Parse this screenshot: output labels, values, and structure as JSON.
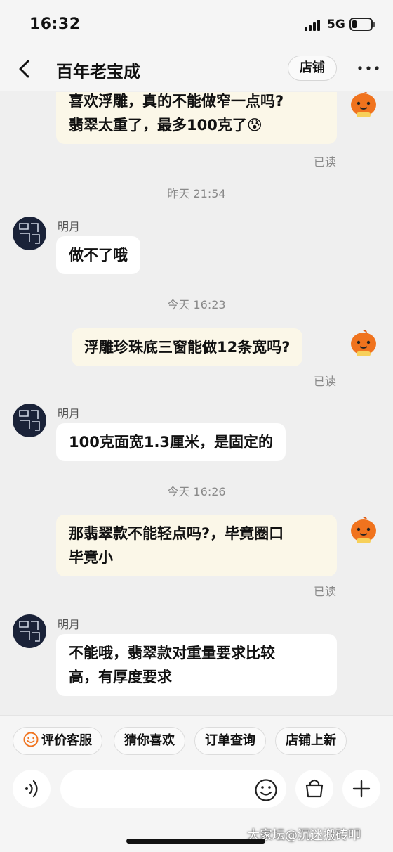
{
  "status": {
    "time": "16:32",
    "network": "5G"
  },
  "nav": {
    "title": "百年老宝成",
    "shop_button": "店铺"
  },
  "messages": [
    {
      "side": "out",
      "lines": [
        "喜欢浮雕，真的不能做窄一点吗?",
        "翡翠太重了，最多100克了"
      ],
      "emoji": "😰",
      "read": "已读"
    },
    {
      "timestamp": "昨天 21:54"
    },
    {
      "side": "in",
      "sender": "明月",
      "text": "做不了哦"
    },
    {
      "timestamp": "今天 16:23"
    },
    {
      "side": "out",
      "text": "浮雕珍珠底三窗能做12条宽吗?",
      "read": "已读"
    },
    {
      "side": "in",
      "sender": "明月",
      "text": "100克面宽1.3厘米，是固定的"
    },
    {
      "timestamp": "今天 16:26"
    },
    {
      "side": "out",
      "lines": [
        "那翡翠款不能轻点吗?，毕竟圈口",
        "毕竟小"
      ],
      "read": "已读"
    },
    {
      "side": "in",
      "sender": "明月",
      "lines": [
        "不能哦，翡翠款对重量要求比较",
        "高，有厚度要求"
      ]
    }
  ],
  "quick_replies": [
    "评价客服",
    "猜你喜欢",
    "订单查询",
    "店铺上新"
  ],
  "input": {
    "placeholder": ""
  },
  "watermark": "大家坛@沉迷搬砖叩",
  "colors": {
    "accent_orange": "#f0731e",
    "outgoing_bubble": "#fbf7e8",
    "incoming_bubble": "#ffffff",
    "background": "#efefef"
  }
}
